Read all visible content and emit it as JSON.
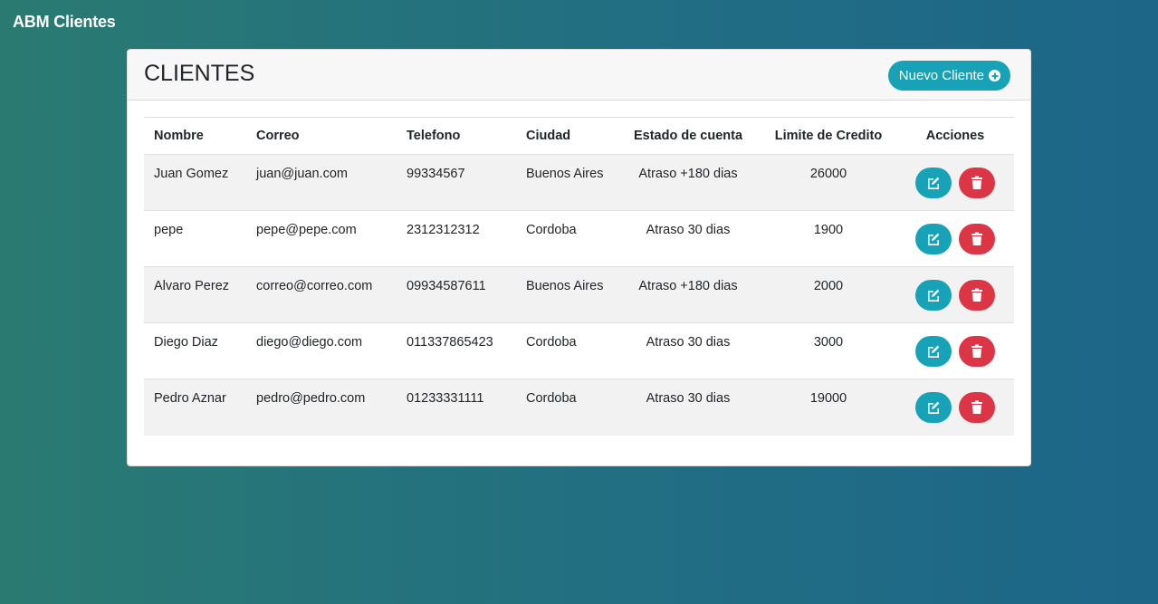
{
  "app": {
    "brand": "ABM Clientes"
  },
  "card": {
    "title": "CLIENTES",
    "new_button_label": "Nuevo Cliente"
  },
  "table": {
    "headers": [
      "Nombre",
      "Correo",
      "Telefono",
      "Ciudad",
      "Estado de cuenta",
      "Limite de Credito",
      "Acciones"
    ],
    "rows": [
      {
        "nombre": "Juan Gomez",
        "correo": "juan@juan.com",
        "telefono": "99334567",
        "ciudad": "Buenos Aires",
        "estado": "Atraso +180 dias",
        "limite": "26000"
      },
      {
        "nombre": "pepe",
        "correo": "pepe@pepe.com",
        "telefono": "2312312312",
        "ciudad": "Cordoba",
        "estado": "Atraso 30 dias",
        "limite": "1900"
      },
      {
        "nombre": "Alvaro Perez",
        "correo": "correo@correo.com",
        "telefono": "09934587611",
        "ciudad": "Buenos Aires",
        "estado": "Atraso +180 dias",
        "limite": "2000"
      },
      {
        "nombre": "Diego Diaz",
        "correo": "diego@diego.com",
        "telefono": "011337865423",
        "ciudad": "Cordoba",
        "estado": "Atraso 30 dias",
        "limite": "3000"
      },
      {
        "nombre": "Pedro Aznar",
        "correo": "pedro@pedro.com",
        "telefono": "01233331111",
        "ciudad": "Cordoba",
        "estado": "Atraso 30 dias",
        "limite": "19000"
      }
    ]
  },
  "icons": {
    "new": "plus-circle-icon",
    "edit": "edit-icon",
    "delete": "trash-icon"
  },
  "colors": {
    "accent": "#17a2b8",
    "danger": "#dc3545"
  }
}
